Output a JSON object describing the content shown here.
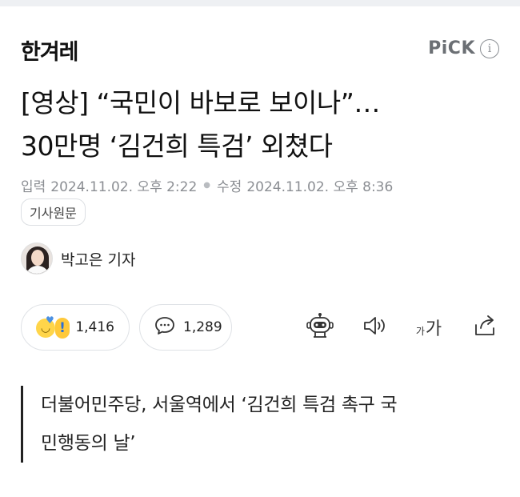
{
  "header": {
    "logo_text": "한겨레",
    "pick_label": "PiCK",
    "pick_info_icon": "i"
  },
  "article": {
    "headline_lines": [
      "[영상] “국민이 바보로 보이나”…",
      "30만명 ‘김건희 특검’ 외쳤다"
    ],
    "published_label": "입력",
    "published_date": "2024.11.02. 오후 2:22",
    "modified_label": "수정",
    "modified_date": "2024.11.02. 오후 8:36",
    "original_button": "기사원문",
    "reporter_name": "박고은 기자",
    "subheadline_lines": [
      "더불어민주당, 서울역에서 ‘김건희 특검 촉구 국",
      "민행동의 날’"
    ]
  },
  "actions": {
    "reaction_count": "1,416",
    "comment_count": "1,289",
    "font_small": "가",
    "font_big": "가"
  },
  "icons": {
    "reaction": "reaction-emoji-icon",
    "comment": "comment-bubble-icon",
    "summary": "robot-summary-icon",
    "listen": "speaker-icon",
    "font": "font-size-icon",
    "share": "share-icon"
  }
}
